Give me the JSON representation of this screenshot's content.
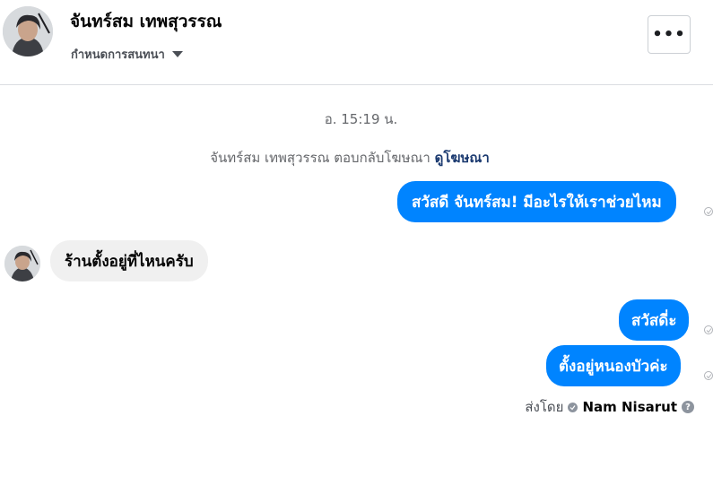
{
  "header": {
    "contact_name": "จันทร์สม เทพสุวรรณ",
    "manage_label": "กำหนดการสนทนา",
    "more_label": "•••"
  },
  "thread": {
    "timestamp": "อ. 15:19 น.",
    "ad_note": "จันทร์สม เทพสุวรรณ ตอบกลับโฆษณา",
    "ad_link": "ดูโฆษณา",
    "messages": [
      {
        "direction": "outgoing",
        "text": "สวัสดี จันทร์สม! มีอะไรให้เราช่วยไหม"
      },
      {
        "direction": "incoming",
        "text": "ร้านตั้งอยู่ที่ไหนครับ"
      },
      {
        "direction": "outgoing",
        "text": "สวัสดี่ะ"
      },
      {
        "direction": "outgoing",
        "text": "ตั้งอยู่หนองบัวค่ะ"
      }
    ],
    "sent_by_label": "ส่งโดย",
    "sent_by_name": "Nam Nisarut",
    "help_glyph": "?"
  },
  "colors": {
    "outgoing_bubble": "#0084ff",
    "incoming_bubble": "#f0f0f0",
    "link": "#1b3a70"
  }
}
